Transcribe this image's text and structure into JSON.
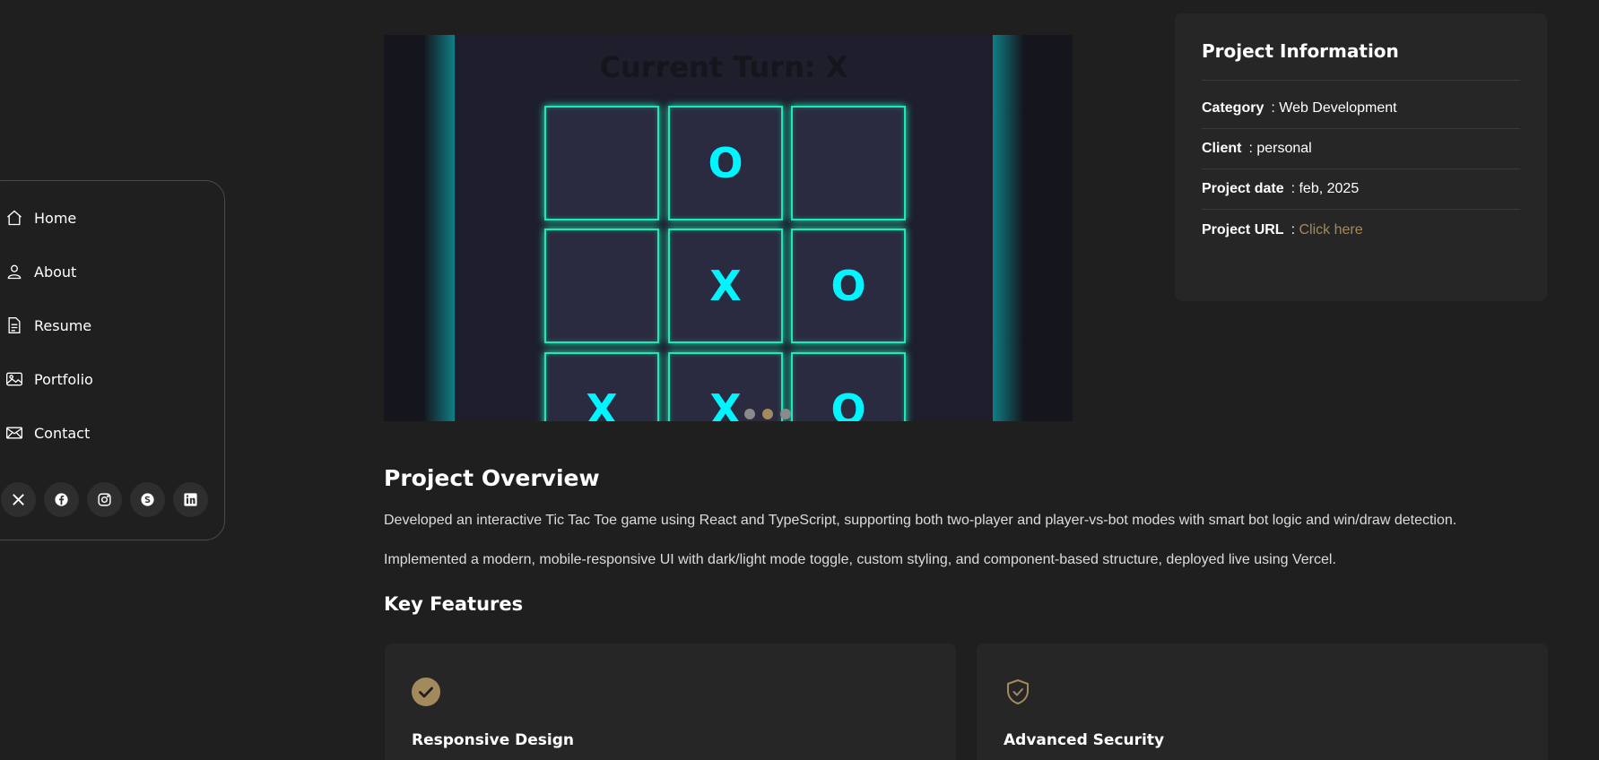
{
  "nav": {
    "items": [
      {
        "label": "Home",
        "icon": "home-icon"
      },
      {
        "label": "About",
        "icon": "user-icon"
      },
      {
        "label": "Resume",
        "icon": "document-icon"
      },
      {
        "label": "Portfolio",
        "icon": "image-icon"
      },
      {
        "label": "Contact",
        "icon": "mail-icon"
      }
    ],
    "socials": [
      "x-icon",
      "facebook-icon",
      "instagram-icon",
      "skype-icon",
      "linkedin-icon"
    ]
  },
  "game": {
    "turn_text": "Current Turn: X",
    "board": [
      "",
      "O",
      "",
      "",
      "X",
      "O",
      "X",
      "X",
      "O"
    ],
    "slide_count": 3,
    "active_slide": 2
  },
  "info": {
    "title": "Project Information",
    "rows": [
      {
        "key": "Category",
        "value": ": Web Development"
      },
      {
        "key": "Client",
        "value": ": personal"
      },
      {
        "key": "Project date",
        "value": ": feb, 2025"
      },
      {
        "key": "Project URL",
        "value": ": ",
        "link": "Click here"
      }
    ]
  },
  "overview": {
    "title": "Project Overview",
    "p1": "Developed an interactive Tic Tac Toe game using React and TypeScript, supporting both two-player and player-vs-bot modes with smart bot logic and win/draw detection.",
    "p2": "Implemented a modern, mobile-responsive UI with dark/light mode toggle, custom styling, and component-based structure, deployed live using Vercel."
  },
  "features": {
    "title": "Key Features",
    "items": [
      {
        "name": "Responsive Design",
        "icon": "check-circle-icon"
      },
      {
        "name": "Advanced Security",
        "icon": "shield-check-icon"
      }
    ]
  },
  "colors": {
    "accent": "#a38a5c",
    "neon": "#00f5ff",
    "cell_border": "#1de9b6",
    "background": "#1f1f1f"
  }
}
